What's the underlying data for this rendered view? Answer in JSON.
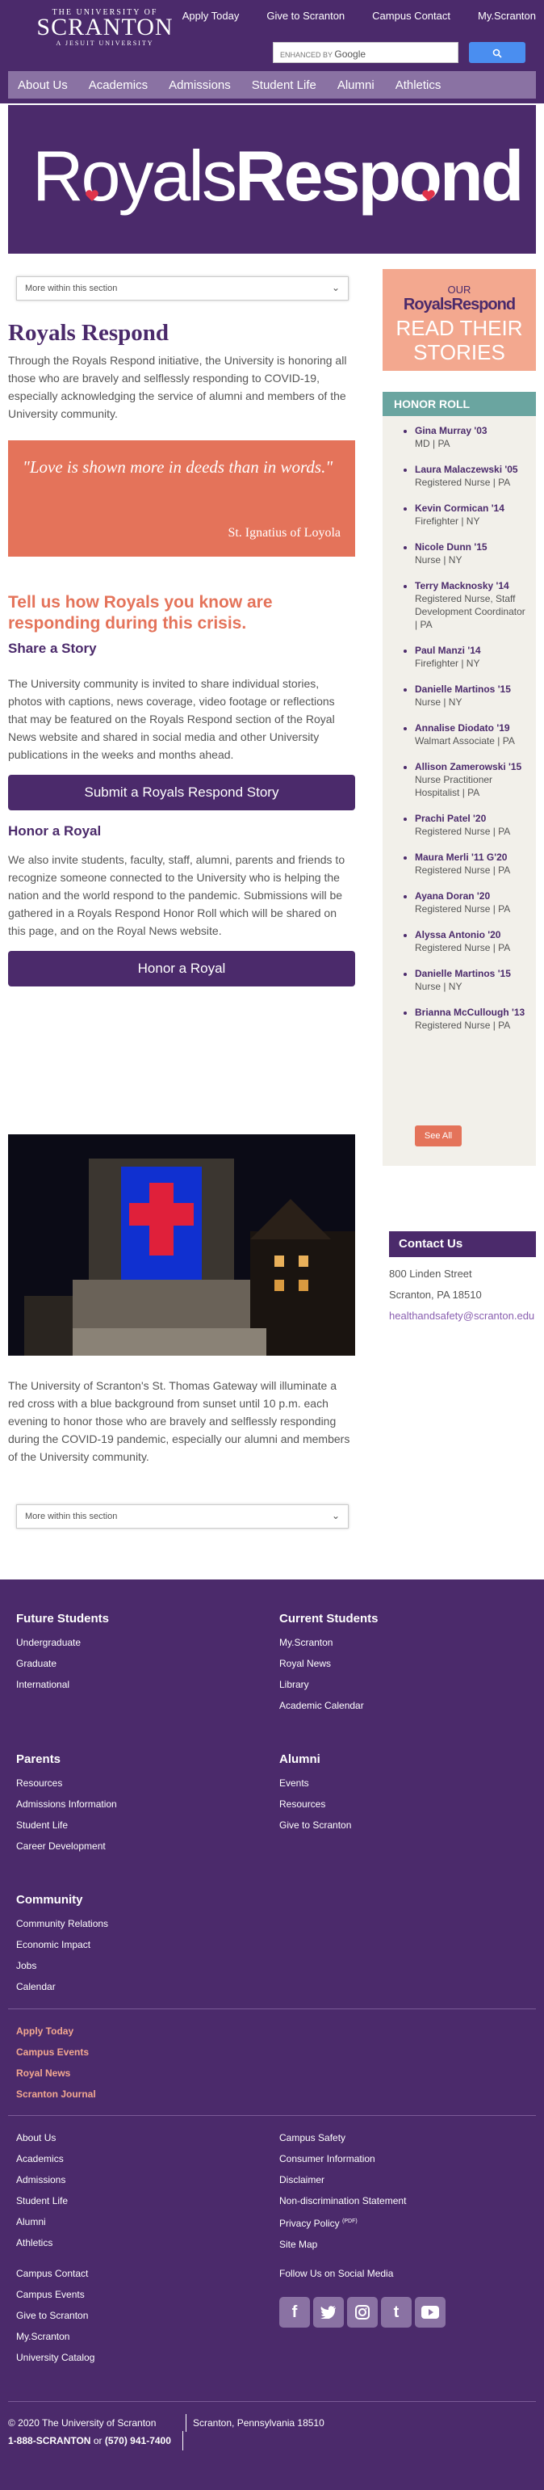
{
  "header": {
    "logo": {
      "line1": "THE UNIVERSITY OF",
      "line2": "SCRANTON",
      "line3": "A JESUIT UNIVERSITY"
    },
    "utility_links": [
      "Apply Today",
      "Give to Scranton",
      "Campus Contact",
      "My.Scranton"
    ],
    "search": {
      "enhanced_by": "ENHANCED BY",
      "brand": "Google"
    },
    "main_nav": [
      "About Us",
      "Academics",
      "Admissions",
      "Student Life",
      "Alumni",
      "Athletics"
    ]
  },
  "hero": {
    "word1": "Royals",
    "word2": "Respond"
  },
  "main": {
    "dropdown_label": "More within this section",
    "title": "Royals Respond",
    "intro": "Through the Royals Respond initiative, the University is honoring all those who are bravely and selflessly responding to COVID-19, especially acknowledging the service of alumni and members of the University community.",
    "quote": {
      "text": "\"Love is shown more in deeds than in words.\"",
      "author": "St. Ignatius of Loyola"
    },
    "tell_heading": "Tell us how Royals you know are responding during this crisis.",
    "share_heading": "Share a Story",
    "share_body": "The University community is invited to share individual stories, photos with captions, news coverage, video footage or reflections that may be featured on the Royals Respond section of the Royal News website and shared in social media and other University publications in the weeks and months ahead.",
    "share_button": "Submit a Royals Respond Story",
    "honor_heading": "Honor a Royal",
    "honor_body": "We also invite students, faculty, staff, alumni, parents and friends to recognize someone connected to the University who is helping the nation and the world respond to the pandemic. Submissions will be gathered in a Royals Respond Honor Roll which will be shared on this page, and on the Royal News website.",
    "honor_button": "Honor a Royal",
    "caption": "The University of Scranton's St. Thomas Gateway will illuminate a red cross with a blue background from sunset until 10 p.m. each evening to honor those who are bravely and selflessly responding during the COVID-19 pandemic, especially our alumni and members of the University community.",
    "dropdown_label_bottom": "More within this section"
  },
  "sidebar": {
    "card": {
      "our": "OUR",
      "brand": "RoyalsRespond",
      "read": "READ THEIR",
      "stories": "STORIES"
    },
    "honor_roll_title": "HONOR ROLL",
    "honor_roll": [
      {
        "name": "Gina Murray '03",
        "detail": "MD | PA"
      },
      {
        "name": "Laura Malaczewski '05",
        "detail": "Registered Nurse | PA"
      },
      {
        "name": "Kevin Cormican '14",
        "detail": "Firefighter | NY"
      },
      {
        "name": "Nicole Dunn '15",
        "detail": "Nurse | NY"
      },
      {
        "name": "Terry Macknosky '14",
        "detail": "Registered Nurse, Staff Development Coordinator | PA"
      },
      {
        "name": "Paul Manzi '14",
        "detail": "Firefighter | NY"
      },
      {
        "name": "Danielle Martinos '15",
        "detail": "Nurse | NY"
      },
      {
        "name": "Annalise Diodato '19",
        "detail": "Walmart Associate | PA"
      },
      {
        "name": "Allison Zamerowski '15",
        "detail": "Nurse Practitioner Hospitalist | PA"
      },
      {
        "name": "Prachi Patel '20",
        "detail": "Registered Nurse | PA"
      },
      {
        "name": "Maura Merli '11 G'20",
        "detail": "Registered Nurse | PA"
      },
      {
        "name": "Ayana Doran '20",
        "detail": "Registered Nurse | PA"
      },
      {
        "name": "Alyssa Antonio '20",
        "detail": "Registered Nurse | PA"
      },
      {
        "name": "Danielle Martinos '15",
        "detail": "Nurse | NY"
      },
      {
        "name": "Brianna McCullough '13",
        "detail": "Registered Nurse | PA"
      }
    ],
    "see_all": "See All",
    "contact": {
      "title": "Contact Us",
      "street": "800 Linden Street",
      "city": "Scranton, PA 18510",
      "email": "healthandsafety@scranton.edu"
    }
  },
  "footer": {
    "future": {
      "title": "Future Students",
      "links": [
        "Undergraduate",
        "Graduate",
        "International"
      ]
    },
    "current": {
      "title": "Current Students",
      "links": [
        "My.Scranton",
        "Royal News",
        "Library",
        "Academic Calendar"
      ]
    },
    "parents": {
      "title": "Parents",
      "links": [
        "Resources",
        "Admissions Information",
        "Student Life",
        "Career Development"
      ]
    },
    "alumni": {
      "title": "Alumni",
      "links": [
        "Events",
        "Resources",
        "Give to Scranton"
      ]
    },
    "community": {
      "title": "Community",
      "links": [
        "Community Relations",
        "Economic Impact",
        "Jobs",
        "Calendar"
      ]
    },
    "highlight_links": [
      "Apply Today",
      "Campus Events",
      "Royal News",
      "Scranton Journal"
    ],
    "col1": [
      "About Us",
      "Academics",
      "Admissions",
      "Student Life",
      "Alumni",
      "Athletics"
    ],
    "col2": [
      "Campus Safety",
      "Consumer Information",
      "Disclaimer",
      "Non-discrimination Statement",
      "Privacy Policy",
      "Site Map"
    ],
    "privacy_sup": "(PDF)",
    "col3": [
      "Campus Contact",
      "Campus Events",
      "Give to Scranton",
      "My.Scranton",
      "University Catalog"
    ],
    "social_title": "Follow Us on Social Media",
    "social_icons": [
      "facebook-icon",
      "twitter-icon",
      "instagram-icon",
      "tumblr-icon",
      "youtube-icon"
    ],
    "copyright": "© 2020 The University of Scranton",
    "address": "Scranton, Pennsylvania 18510",
    "phone1": "1-888-SCRANTON",
    "phone_or": "or",
    "phone2": "(570) 941-7400"
  },
  "colors": {
    "purple": "#4b2a6b",
    "coral": "#e4735a",
    "teal": "#6aa5a0",
    "lavender": "#8a72a3"
  }
}
